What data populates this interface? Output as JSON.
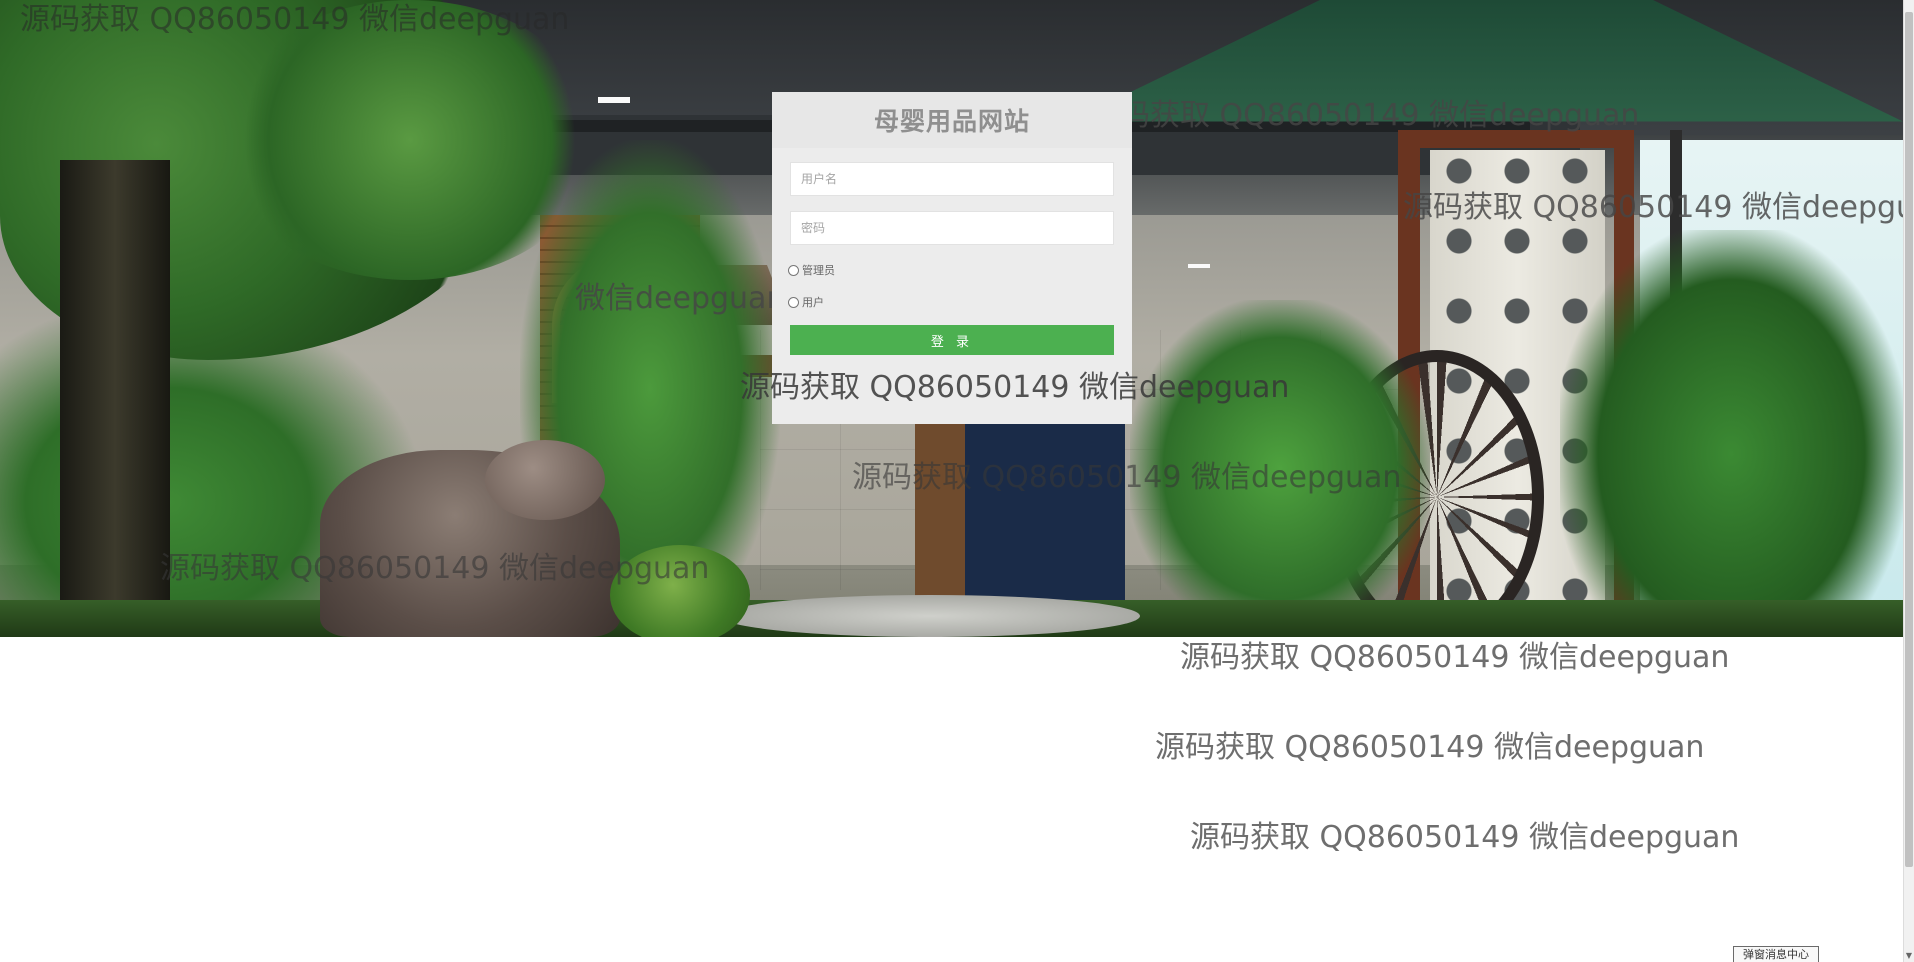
{
  "site": {
    "title": "母婴用品网站"
  },
  "login_form": {
    "username_placeholder": "用户名",
    "password_placeholder": "密码",
    "roles": [
      "管理员",
      "用户"
    ],
    "submit_label": "登 录",
    "submit_color": "#4cb050"
  },
  "watermark": {
    "text": "源码获取 QQ86050149 微信deepguan",
    "fragments": {
      "top_left": "源码获取 QQ86050149 微信deepguan",
      "left_mid": "微信deepguan",
      "center": "源码获取 QQ86050149 微信deepguan"
    }
  },
  "popup": {
    "label": "弹窗消息中心"
  },
  "background": {
    "description_icon": "garden-scene-image"
  }
}
